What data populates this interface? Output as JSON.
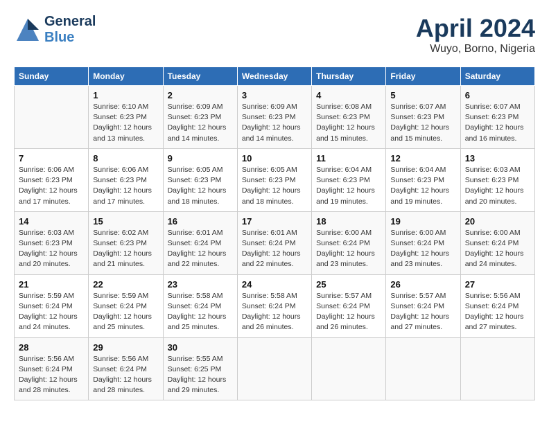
{
  "header": {
    "logo_general": "General",
    "logo_blue": "Blue",
    "month_title": "April 2024",
    "location": "Wuyo, Borno, Nigeria"
  },
  "days_of_week": [
    "Sunday",
    "Monday",
    "Tuesday",
    "Wednesday",
    "Thursday",
    "Friday",
    "Saturday"
  ],
  "weeks": [
    [
      {
        "day": "",
        "info": ""
      },
      {
        "day": "1",
        "info": "Sunrise: 6:10 AM\nSunset: 6:23 PM\nDaylight: 12 hours\nand 13 minutes."
      },
      {
        "day": "2",
        "info": "Sunrise: 6:09 AM\nSunset: 6:23 PM\nDaylight: 12 hours\nand 14 minutes."
      },
      {
        "day": "3",
        "info": "Sunrise: 6:09 AM\nSunset: 6:23 PM\nDaylight: 12 hours\nand 14 minutes."
      },
      {
        "day": "4",
        "info": "Sunrise: 6:08 AM\nSunset: 6:23 PM\nDaylight: 12 hours\nand 15 minutes."
      },
      {
        "day": "5",
        "info": "Sunrise: 6:07 AM\nSunset: 6:23 PM\nDaylight: 12 hours\nand 15 minutes."
      },
      {
        "day": "6",
        "info": "Sunrise: 6:07 AM\nSunset: 6:23 PM\nDaylight: 12 hours\nand 16 minutes."
      }
    ],
    [
      {
        "day": "7",
        "info": "Sunrise: 6:06 AM\nSunset: 6:23 PM\nDaylight: 12 hours\nand 17 minutes."
      },
      {
        "day": "8",
        "info": "Sunrise: 6:06 AM\nSunset: 6:23 PM\nDaylight: 12 hours\nand 17 minutes."
      },
      {
        "day": "9",
        "info": "Sunrise: 6:05 AM\nSunset: 6:23 PM\nDaylight: 12 hours\nand 18 minutes."
      },
      {
        "day": "10",
        "info": "Sunrise: 6:05 AM\nSunset: 6:23 PM\nDaylight: 12 hours\nand 18 minutes."
      },
      {
        "day": "11",
        "info": "Sunrise: 6:04 AM\nSunset: 6:23 PM\nDaylight: 12 hours\nand 19 minutes."
      },
      {
        "day": "12",
        "info": "Sunrise: 6:04 AM\nSunset: 6:23 PM\nDaylight: 12 hours\nand 19 minutes."
      },
      {
        "day": "13",
        "info": "Sunrise: 6:03 AM\nSunset: 6:23 PM\nDaylight: 12 hours\nand 20 minutes."
      }
    ],
    [
      {
        "day": "14",
        "info": "Sunrise: 6:03 AM\nSunset: 6:23 PM\nDaylight: 12 hours\nand 20 minutes."
      },
      {
        "day": "15",
        "info": "Sunrise: 6:02 AM\nSunset: 6:23 PM\nDaylight: 12 hours\nand 21 minutes."
      },
      {
        "day": "16",
        "info": "Sunrise: 6:01 AM\nSunset: 6:24 PM\nDaylight: 12 hours\nand 22 minutes."
      },
      {
        "day": "17",
        "info": "Sunrise: 6:01 AM\nSunset: 6:24 PM\nDaylight: 12 hours\nand 22 minutes."
      },
      {
        "day": "18",
        "info": "Sunrise: 6:00 AM\nSunset: 6:24 PM\nDaylight: 12 hours\nand 23 minutes."
      },
      {
        "day": "19",
        "info": "Sunrise: 6:00 AM\nSunset: 6:24 PM\nDaylight: 12 hours\nand 23 minutes."
      },
      {
        "day": "20",
        "info": "Sunrise: 6:00 AM\nSunset: 6:24 PM\nDaylight: 12 hours\nand 24 minutes."
      }
    ],
    [
      {
        "day": "21",
        "info": "Sunrise: 5:59 AM\nSunset: 6:24 PM\nDaylight: 12 hours\nand 24 minutes."
      },
      {
        "day": "22",
        "info": "Sunrise: 5:59 AM\nSunset: 6:24 PM\nDaylight: 12 hours\nand 25 minutes."
      },
      {
        "day": "23",
        "info": "Sunrise: 5:58 AM\nSunset: 6:24 PM\nDaylight: 12 hours\nand 25 minutes."
      },
      {
        "day": "24",
        "info": "Sunrise: 5:58 AM\nSunset: 6:24 PM\nDaylight: 12 hours\nand 26 minutes."
      },
      {
        "day": "25",
        "info": "Sunrise: 5:57 AM\nSunset: 6:24 PM\nDaylight: 12 hours\nand 26 minutes."
      },
      {
        "day": "26",
        "info": "Sunrise: 5:57 AM\nSunset: 6:24 PM\nDaylight: 12 hours\nand 27 minutes."
      },
      {
        "day": "27",
        "info": "Sunrise: 5:56 AM\nSunset: 6:24 PM\nDaylight: 12 hours\nand 27 minutes."
      }
    ],
    [
      {
        "day": "28",
        "info": "Sunrise: 5:56 AM\nSunset: 6:24 PM\nDaylight: 12 hours\nand 28 minutes."
      },
      {
        "day": "29",
        "info": "Sunrise: 5:56 AM\nSunset: 6:24 PM\nDaylight: 12 hours\nand 28 minutes."
      },
      {
        "day": "30",
        "info": "Sunrise: 5:55 AM\nSunset: 6:25 PM\nDaylight: 12 hours\nand 29 minutes."
      },
      {
        "day": "",
        "info": ""
      },
      {
        "day": "",
        "info": ""
      },
      {
        "day": "",
        "info": ""
      },
      {
        "day": "",
        "info": ""
      }
    ]
  ]
}
